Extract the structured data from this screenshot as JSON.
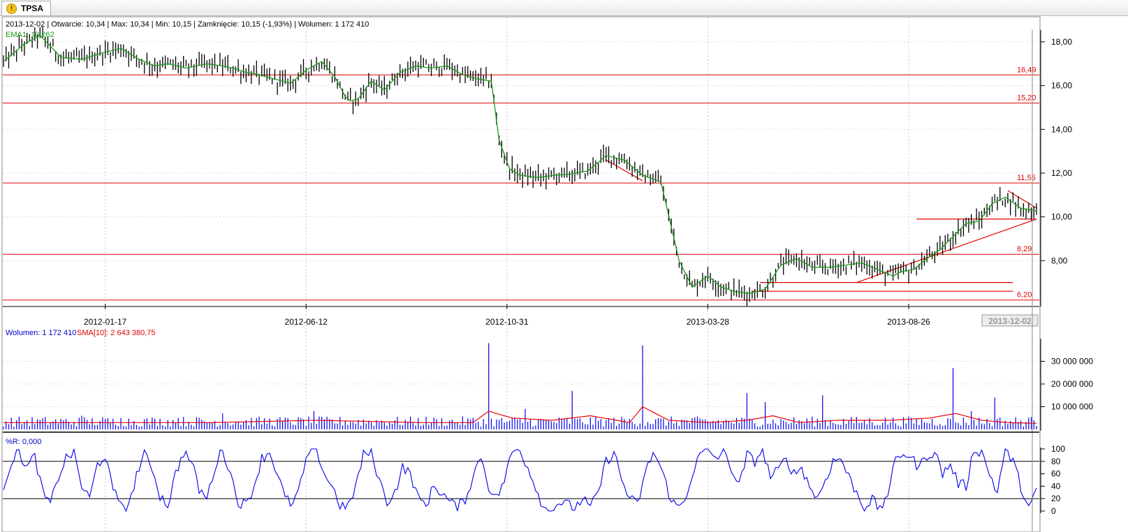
{
  "tab": {
    "title": "TPSA",
    "icon": "warning-icon"
  },
  "header": {
    "info_line": "2013-12-02 | Otwarcie: 10,34 | Max: 10,34 | Min: 10,15 | Zamknięcie: 10,15 (-1,93%) | Wolumen: 1 172 410",
    "ema_label": "EMA1: 10,262"
  },
  "volume_panel": {
    "vol_label": "Wolumen: 1 172 410",
    "sma_label": "SMA[10]: 2 643 380,75"
  },
  "wr_panel": {
    "label": "%R: 0,000"
  },
  "colors": {
    "up": "#000000",
    "ema": "#1a9a1a",
    "levels": "#e00000",
    "volume": "#0000ee",
    "sma": "#ee0000",
    "wr": "#0000ee"
  },
  "chart_data": [
    {
      "type": "line",
      "title": "",
      "series": [
        {
          "name": "EMA1",
          "x_index": [
            0,
            8,
            14,
            22,
            30,
            38,
            45,
            52,
            58,
            63,
            70,
            78,
            84,
            88,
            93,
            98,
            104,
            110,
            116,
            122,
            127,
            131,
            133,
            136,
            141,
            146,
            152,
            158,
            164,
            170,
            176,
            182,
            187,
            190,
            194,
            198,
            205,
            211,
            217,
            224,
            231,
            238,
            245,
            252,
            259,
            264,
            270,
            275,
            280,
            286,
            292,
            298,
            304,
            310,
            317,
            323,
            329,
            335,
            341,
            344,
            349,
            354,
            359,
            364,
            369,
            374,
            379,
            384,
            390,
            396
          ],
          "values": [
            17.1,
            17.9,
            18.3,
            17.3,
            17.2,
            17.5,
            17.7,
            17.2,
            16.9,
            17.0,
            16.8,
            17.0,
            16.9,
            16.8,
            16.6,
            16.5,
            16.3,
            16.1,
            16.7,
            17.1,
            16.4,
            15.5,
            15.3,
            15.4,
            16.2,
            15.8,
            16.6,
            16.9,
            16.8,
            16.9,
            16.5,
            16.3,
            16.2,
            13.5,
            12.2,
            11.9,
            11.8,
            11.9,
            11.95,
            12.1,
            12.8,
            12.6,
            11.9,
            11.6,
            8.0,
            6.8,
            7.3,
            6.8,
            6.6,
            6.5,
            6.7,
            7.8,
            8.1,
            7.7,
            7.7,
            7.8,
            7.9,
            7.6,
            7.3,
            7.5,
            7.6,
            8.1,
            8.5,
            9.1,
            9.7,
            9.8,
            10.6,
            10.9,
            10.4,
            10.26
          ]
        }
      ],
      "x_ticks": [
        "2012-01-17",
        "2012-06-12",
        "2012-10-31",
        "2013-03-28",
        "2013-08-26"
      ],
      "x_tick_index": [
        39,
        116,
        193,
        270,
        347
      ],
      "x_last_label": "2013-12-02",
      "y_ticks": [
        "18,00",
        "16,00",
        "14,00",
        "12,00",
        "10,00",
        "8,00"
      ],
      "ylim": [
        6.0,
        18.7
      ],
      "h_levels": [
        16.49,
        15.2,
        11.55,
        8.29,
        6.2
      ],
      "h_level_labels": [
        "16,49",
        "15,20",
        "11,55",
        "8,29",
        "6,20"
      ],
      "grid": true
    },
    {
      "type": "bar",
      "title": "",
      "series": [
        {
          "name": "Wolumen",
          "spikes_index": [
            30,
            45,
            67,
            84,
            119,
            186,
            200,
            218,
            245,
            285,
            292,
            314,
            364,
            371,
            380,
            395
          ],
          "spikes_values": [
            6000000,
            5000000,
            5000000,
            7000000,
            8000000,
            38000000,
            9000000,
            17000000,
            37000000,
            16000000,
            12000000,
            15000000,
            27000000,
            8000000,
            14000000,
            4000000
          ]
        },
        {
          "name": "SMA[10]",
          "x_index": [
            0,
            40,
            80,
            120,
            160,
            180,
            186,
            195,
            210,
            225,
            240,
            245,
            255,
            270,
            285,
            295,
            305,
            320,
            340,
            355,
            365,
            375,
            385,
            396
          ],
          "values": [
            3000000,
            3000000,
            3000000,
            4000000,
            3000000,
            3000000,
            8000000,
            5000000,
            4000000,
            6000000,
            3000000,
            10000000,
            4000000,
            3000000,
            4000000,
            6000000,
            3000000,
            4000000,
            4000000,
            5000000,
            7000000,
            4000000,
            3000000,
            2643380.75
          ]
        }
      ],
      "y_ticks": [
        "30 000 000",
        "20 000 000",
        "10 000 000"
      ],
      "ylim": [
        0,
        40000000
      ],
      "grid": true
    },
    {
      "type": "line",
      "title": "",
      "series": [
        {
          "name": "%R",
          "x_index": [
            0,
            3,
            6,
            9,
            12,
            15,
            18,
            21,
            24,
            27,
            30,
            33,
            36,
            39,
            42,
            45,
            48,
            51,
            54,
            57,
            60,
            63,
            66,
            69,
            72,
            75,
            78,
            81,
            84,
            87,
            90,
            93,
            96,
            99,
            102,
            105,
            108,
            111,
            114,
            117,
            120,
            123,
            126,
            129,
            132,
            135,
            138,
            141,
            144,
            147,
            150,
            153,
            156,
            159,
            162,
            165,
            168,
            171,
            174,
            177,
            180,
            183,
            186,
            189,
            192,
            195,
            198,
            201,
            204,
            207,
            210,
            213,
            216,
            219,
            222,
            225,
            228,
            231,
            234,
            237,
            240,
            243,
            246,
            249,
            252,
            255,
            258,
            261,
            264,
            267,
            270,
            273,
            276,
            279,
            282,
            285,
            288,
            291,
            294,
            297,
            300,
            303,
            306,
            309,
            312,
            315,
            318,
            321,
            324,
            327,
            330,
            333,
            336,
            339,
            342,
            345,
            348,
            351,
            354,
            357,
            360,
            363,
            366,
            369,
            372,
            375,
            378,
            381,
            384,
            387,
            390,
            393,
            396
          ],
          "values": [
            40,
            80,
            95,
            70,
            88,
            30,
            10,
            55,
            85,
            95,
            40,
            20,
            75,
            90,
            30,
            15,
            5,
            60,
            90,
            70,
            25,
            10,
            60,
            95,
            80,
            35,
            20,
            70,
            100,
            60,
            15,
            10,
            40,
            85,
            95,
            60,
            20,
            10,
            45,
            95,
            100,
            60,
            40,
            10,
            5,
            40,
            90,
            95,
            50,
            15,
            30,
            70,
            60,
            20,
            10,
            40,
            30,
            15,
            5,
            20,
            55,
            90,
            40,
            20,
            50,
            95,
            100,
            70,
            40,
            5,
            0,
            15,
            10,
            5,
            20,
            5,
            30,
            80,
            95,
            50,
            20,
            10,
            60,
            95,
            70,
            30,
            5,
            15,
            60,
            90,
            100,
            85,
            95,
            70,
            40,
            90,
            80,
            100,
            55,
            65,
            85,
            60,
            70,
            40,
            20,
            50,
            80,
            85,
            55,
            30,
            5,
            20,
            0,
            30,
            80,
            95,
            85,
            70,
            90,
            95,
            60,
            75,
            45,
            40,
            100,
            95,
            60,
            30,
            100,
            80,
            40,
            5,
            30
          ]
        }
      ],
      "y_ticks": [
        "100",
        "80",
        "60",
        "40",
        "20",
        "0"
      ],
      "ylim": [
        0,
        100
      ],
      "h_levels": [
        80,
        20
      ],
      "grid": true
    }
  ]
}
